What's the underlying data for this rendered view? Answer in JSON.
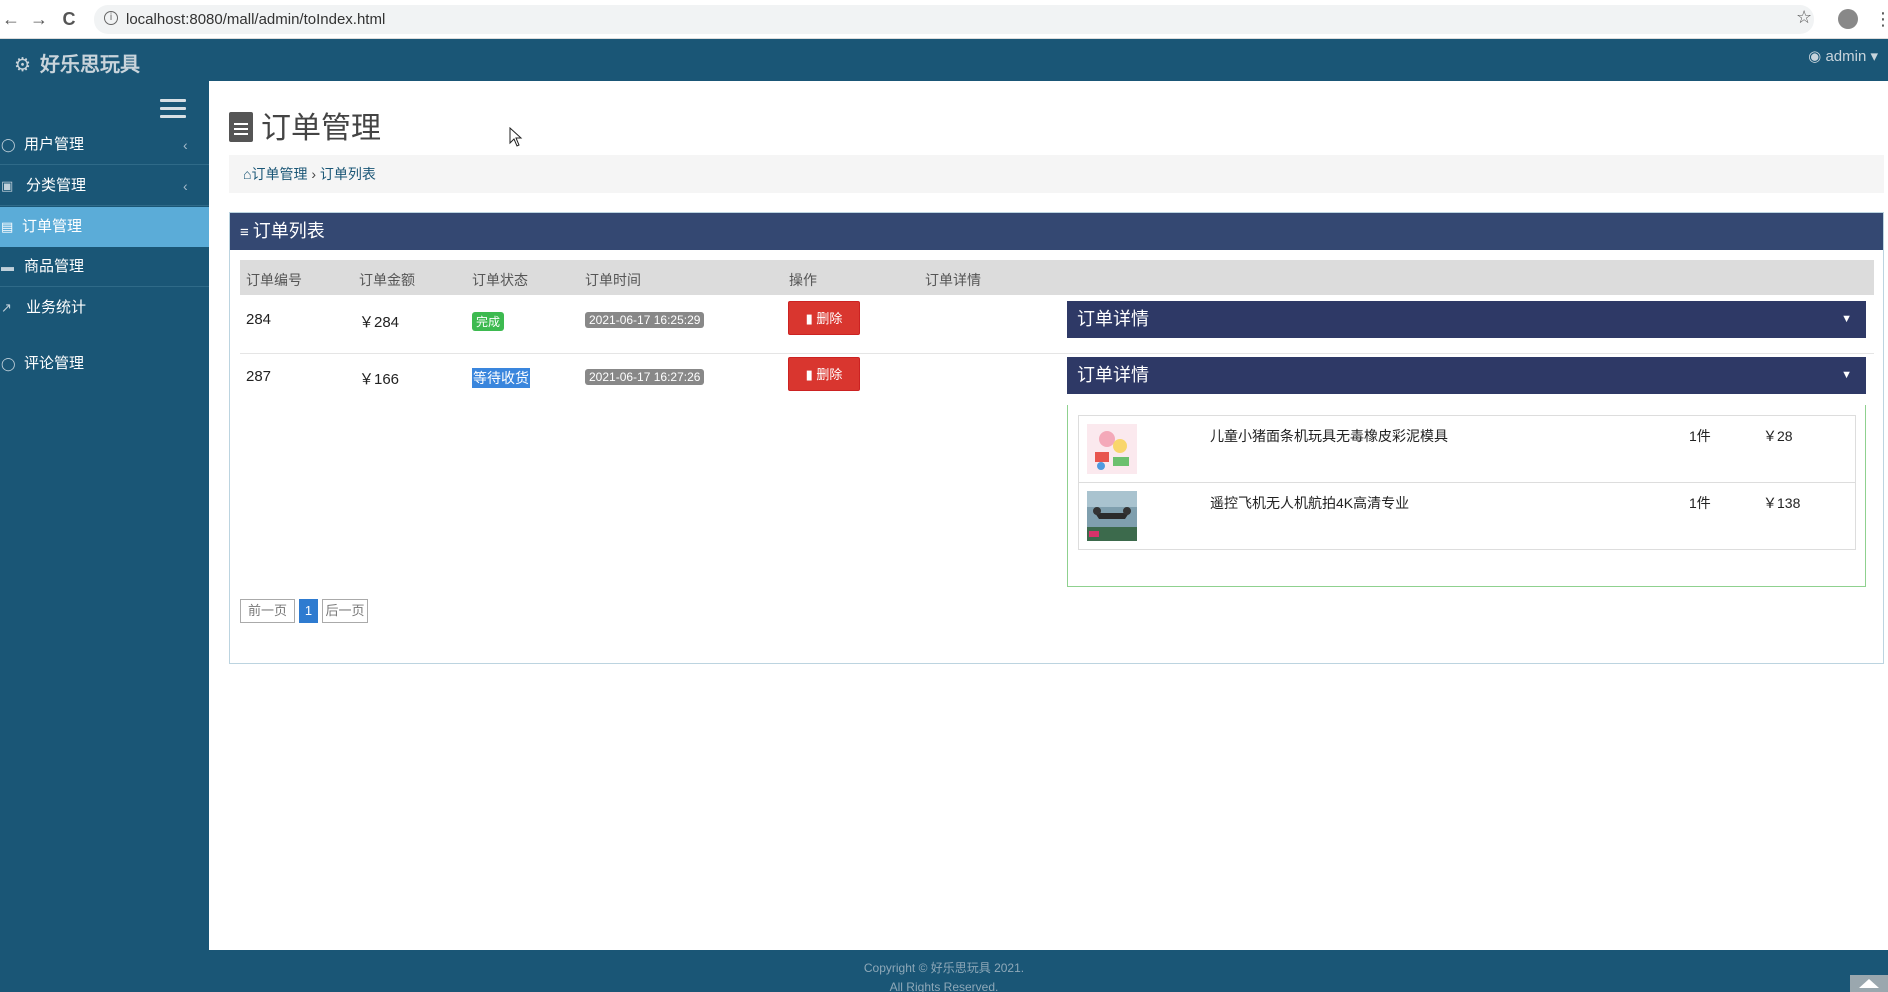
{
  "browser": {
    "back_glyph": "←",
    "forward_glyph": "→",
    "reload_glyph": "C",
    "url": "localhost:8080/mall/admin/toIndex.html",
    "star_glyph": "☆",
    "menu_glyph": "⋮"
  },
  "header": {
    "brand": "好乐思玩具",
    "brand_icon": "cubes-icon",
    "user": "admin ▾",
    "bg": "#1a5676"
  },
  "sidebar": {
    "items": [
      {
        "label": "用户管理",
        "icon": "user-icon",
        "caret": "‹"
      },
      {
        "label": "分类管理",
        "icon": "category-icon",
        "caret": "‹"
      },
      {
        "label": "订单管理",
        "icon": "file-icon",
        "caret": ""
      },
      {
        "label": "商品管理",
        "icon": "basket-icon",
        "caret": ""
      },
      {
        "label": "业务统计",
        "icon": "chart-icon",
        "caret": ""
      },
      {
        "label": "评论管理",
        "icon": "comment-icon",
        "caret": ""
      }
    ],
    "active_color": "#5bacd8"
  },
  "main": {
    "title": "订单管理",
    "breadcrumb": {
      "home": "订单管理",
      "sep": " › ",
      "current": "订单列表"
    },
    "panel_title": "订单列表",
    "columns": [
      "订单编号",
      "订单金额",
      "订单状态",
      "订单时间",
      "操作",
      "订单详情"
    ],
    "orders": [
      {
        "id": "284",
        "amount": "￥284",
        "status": "完成",
        "time": "2021-06-17 16:25:29",
        "action": "删除",
        "detail_title": "订单详情"
      },
      {
        "id": "287",
        "amount": "￥166",
        "status": "等待收货",
        "time": "2021-06-17 16:27:26",
        "action": "删除",
        "detail_title": "订单详情"
      }
    ],
    "detail_items": [
      {
        "name": "儿童小猪面条机玩具无毒橡皮彩泥模具",
        "qty": "1件",
        "price": "￥28"
      },
      {
        "name": "遥控飞机无人机航拍4K高清专业",
        "qty": "1件",
        "price": "￥138"
      }
    ],
    "pager": {
      "prev": "前一页",
      "current": "1",
      "next": "后一页"
    }
  },
  "footer": {
    "line1": "Copyright © 好乐思玩具 2021.",
    "line2": "All Rights Reserved."
  }
}
